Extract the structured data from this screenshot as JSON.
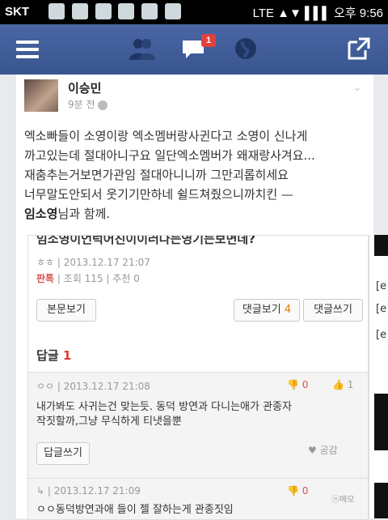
{
  "statusbar": {
    "carrier": "SKT",
    "right_text": "LTE ▲▼ ▌▌▌ 오후 9:56"
  },
  "navbar": {
    "notification_count": "1"
  },
  "post": {
    "author": "이승민",
    "time": "9분 전",
    "lines": [
      "엑소빠들이 소영이랑 엑소멤버랑사귄다고 소영이 신나게",
      "까고있는데 절대아니구요 일단엑소멤버가 왜재랑사겨요...",
      "재춤추는거보면가관임 절대아니니까 그만괴롭히세요",
      "너무말도안되서 웃기기만하네 쉴드쳐줬으니까치킨 —"
    ],
    "tagged_name": "임소영",
    "tag_suffix": "님과 함께."
  },
  "shared_post": {
    "cut_title": "임소영이언럭어진이이러다는영기는보면데?",
    "meta_author": "ㅎㅎ",
    "meta_date": "2013.12.17 21:07",
    "pan_label": "판톡",
    "views": "조회 115",
    "recommend": "추천 0",
    "btn_view_body": "본문보기",
    "btn_view_comments": "댓글보기",
    "btn_view_comments_count": "4",
    "btn_write_comment": "댓글쓰기",
    "replies_label": "답글",
    "replies_count": "1",
    "comment1": {
      "author": "ㅇㅇ",
      "date": "2013.12.17 21:08",
      "down": "0",
      "up": "1",
      "line1": "내가봐도 사귀는건 맞는듯. 동덕 방연과 다니는애가 관종자",
      "line2": "작짓할까,그냥 무식하게 티냇을뿐",
      "reply_btn": "답글쓰기",
      "like": "공감"
    },
    "comment2": {
      "date": "2013.12.17 21:09",
      "down": "0",
      "line1": "ㅇㅇ동덕방연과애 들이 젤 잘하는게 관종짓임"
    }
  },
  "watermark": "ⓝ메모",
  "right_strip": {
    "items": [
      "[e",
      "[e",
      "[e"
    ]
  }
}
